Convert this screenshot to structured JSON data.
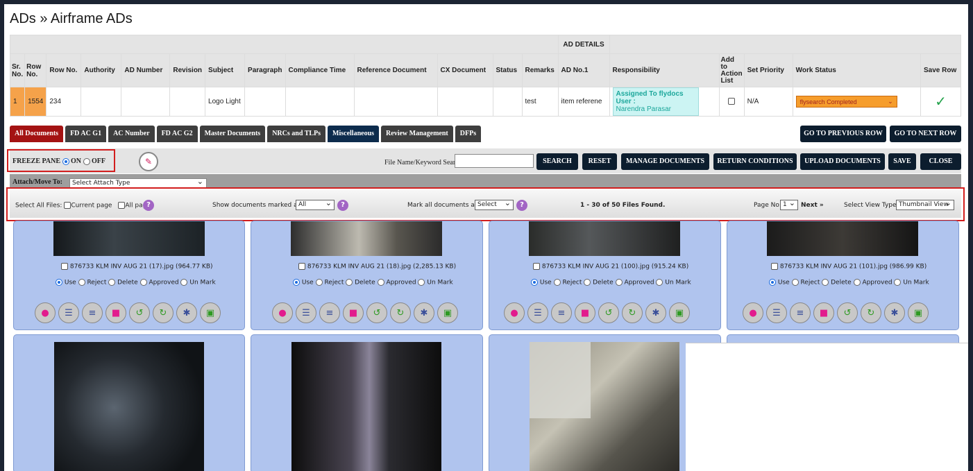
{
  "title": "ADs » Airframe ADs",
  "ad_table": {
    "group_header": "AD DETAILS",
    "columns": [
      "Sr. No.",
      "Row No.",
      "Row No.",
      "Authority",
      "AD Number",
      "Revision",
      "Subject",
      "Paragraph",
      "Compliance Time",
      "Reference Document",
      "CX Document",
      "Status",
      "Remarks",
      "AD No.1",
      "Responsibility",
      "Add to Action List",
      "Set Priority",
      "Work Status",
      "Save Row"
    ],
    "row": {
      "sr_no": "1",
      "row_no": "1554",
      "row_no2": "234",
      "subject": "Logo Light",
      "remarks": "test",
      "ad_no1": "item referene",
      "responsibility_title": "Assigned To flydocs User :",
      "responsibility_user": "Narendra Parasar",
      "set_priority": "N/A",
      "work_status": "flysearch Completed",
      "save_icon": "check-icon"
    }
  },
  "tabs": [
    "All Documents",
    "FD AC G1",
    "AC Number",
    "FD AC G2",
    "Master Documents",
    "NRCs and TLPs",
    "Miscellaneous",
    "Review Management",
    "DFPs"
  ],
  "nav_buttons": {
    "prev": "GO TO PREVIOUS ROW",
    "next": "GO TO NEXT ROW"
  },
  "freeze": {
    "label": "FREEZE PANE",
    "on": "ON",
    "off": "OFF"
  },
  "search": {
    "label": "File Name/Keyword Search",
    "value": ""
  },
  "actions": [
    "SEARCH",
    "RESET",
    "MANAGE DOCUMENTS",
    "RETURN CONDITIONS",
    "UPLOAD DOCUMENTS",
    "SAVE",
    "CLOSE"
  ],
  "attach": {
    "label": "Attach/Move To:",
    "select": "Select Attach Type"
  },
  "files_bar": {
    "select_all": "Select All Files:",
    "current_page": "Current page",
    "all_pages": "All pages",
    "show_label": "Show documents marked as:",
    "show_value": "All",
    "mark_label": "Mark all documents as:",
    "mark_value": "Select",
    "count": "1 - 30 of 50 Files Found.",
    "page_label": "Page No:",
    "page_value": "1",
    "next": "Next »",
    "view_label": "Select View Type :",
    "view_value": "Thumbnail View"
  },
  "cards": [
    {
      "filename": "876733 KLM INV AUG 21 (17).jpg (964.77 KB)"
    },
    {
      "filename": "876733 KLM INV AUG 21 (18).jpg (2,285.13 KB)"
    },
    {
      "filename": "876733 KLM INV AUG 21 (100).jpg (915.24 KB)"
    },
    {
      "filename": "876733 KLM INV AUG 21 (101).jpg (986.99 KB)"
    }
  ],
  "doc_options": [
    "Use",
    "Reject",
    "Delete",
    "Approved",
    "Un Mark"
  ],
  "help_glyph": "?",
  "colors": {
    "tab_active": "#a41313",
    "tab": "#3e3e3e",
    "card": "#b0c4ee",
    "highlight_border": "#d21d1d"
  }
}
